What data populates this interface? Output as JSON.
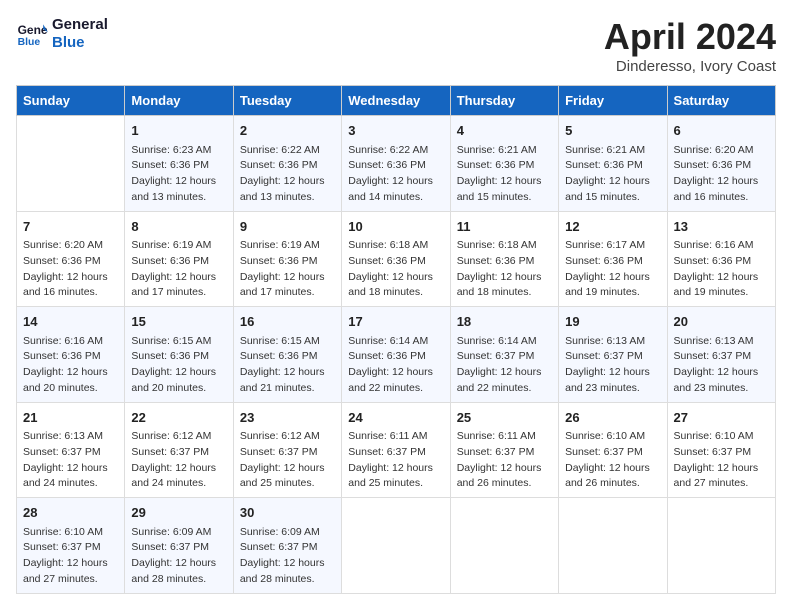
{
  "header": {
    "logo_line1": "General",
    "logo_line2": "Blue",
    "title": "April 2024",
    "location": "Dinderesso, Ivory Coast"
  },
  "days_of_week": [
    "Sunday",
    "Monday",
    "Tuesday",
    "Wednesday",
    "Thursday",
    "Friday",
    "Saturday"
  ],
  "weeks": [
    [
      {
        "day": "",
        "info": ""
      },
      {
        "day": "1",
        "info": "Sunrise: 6:23 AM\nSunset: 6:36 PM\nDaylight: 12 hours\nand 13 minutes."
      },
      {
        "day": "2",
        "info": "Sunrise: 6:22 AM\nSunset: 6:36 PM\nDaylight: 12 hours\nand 13 minutes."
      },
      {
        "day": "3",
        "info": "Sunrise: 6:22 AM\nSunset: 6:36 PM\nDaylight: 12 hours\nand 14 minutes."
      },
      {
        "day": "4",
        "info": "Sunrise: 6:21 AM\nSunset: 6:36 PM\nDaylight: 12 hours\nand 15 minutes."
      },
      {
        "day": "5",
        "info": "Sunrise: 6:21 AM\nSunset: 6:36 PM\nDaylight: 12 hours\nand 15 minutes."
      },
      {
        "day": "6",
        "info": "Sunrise: 6:20 AM\nSunset: 6:36 PM\nDaylight: 12 hours\nand 16 minutes."
      }
    ],
    [
      {
        "day": "7",
        "info": "Sunrise: 6:20 AM\nSunset: 6:36 PM\nDaylight: 12 hours\nand 16 minutes."
      },
      {
        "day": "8",
        "info": "Sunrise: 6:19 AM\nSunset: 6:36 PM\nDaylight: 12 hours\nand 17 minutes."
      },
      {
        "day": "9",
        "info": "Sunrise: 6:19 AM\nSunset: 6:36 PM\nDaylight: 12 hours\nand 17 minutes."
      },
      {
        "day": "10",
        "info": "Sunrise: 6:18 AM\nSunset: 6:36 PM\nDaylight: 12 hours\nand 18 minutes."
      },
      {
        "day": "11",
        "info": "Sunrise: 6:18 AM\nSunset: 6:36 PM\nDaylight: 12 hours\nand 18 minutes."
      },
      {
        "day": "12",
        "info": "Sunrise: 6:17 AM\nSunset: 6:36 PM\nDaylight: 12 hours\nand 19 minutes."
      },
      {
        "day": "13",
        "info": "Sunrise: 6:16 AM\nSunset: 6:36 PM\nDaylight: 12 hours\nand 19 minutes."
      }
    ],
    [
      {
        "day": "14",
        "info": "Sunrise: 6:16 AM\nSunset: 6:36 PM\nDaylight: 12 hours\nand 20 minutes."
      },
      {
        "day": "15",
        "info": "Sunrise: 6:15 AM\nSunset: 6:36 PM\nDaylight: 12 hours\nand 20 minutes."
      },
      {
        "day": "16",
        "info": "Sunrise: 6:15 AM\nSunset: 6:36 PM\nDaylight: 12 hours\nand 21 minutes."
      },
      {
        "day": "17",
        "info": "Sunrise: 6:14 AM\nSunset: 6:36 PM\nDaylight: 12 hours\nand 22 minutes."
      },
      {
        "day": "18",
        "info": "Sunrise: 6:14 AM\nSunset: 6:37 PM\nDaylight: 12 hours\nand 22 minutes."
      },
      {
        "day": "19",
        "info": "Sunrise: 6:13 AM\nSunset: 6:37 PM\nDaylight: 12 hours\nand 23 minutes."
      },
      {
        "day": "20",
        "info": "Sunrise: 6:13 AM\nSunset: 6:37 PM\nDaylight: 12 hours\nand 23 minutes."
      }
    ],
    [
      {
        "day": "21",
        "info": "Sunrise: 6:13 AM\nSunset: 6:37 PM\nDaylight: 12 hours\nand 24 minutes."
      },
      {
        "day": "22",
        "info": "Sunrise: 6:12 AM\nSunset: 6:37 PM\nDaylight: 12 hours\nand 24 minutes."
      },
      {
        "day": "23",
        "info": "Sunrise: 6:12 AM\nSunset: 6:37 PM\nDaylight: 12 hours\nand 25 minutes."
      },
      {
        "day": "24",
        "info": "Sunrise: 6:11 AM\nSunset: 6:37 PM\nDaylight: 12 hours\nand 25 minutes."
      },
      {
        "day": "25",
        "info": "Sunrise: 6:11 AM\nSunset: 6:37 PM\nDaylight: 12 hours\nand 26 minutes."
      },
      {
        "day": "26",
        "info": "Sunrise: 6:10 AM\nSunset: 6:37 PM\nDaylight: 12 hours\nand 26 minutes."
      },
      {
        "day": "27",
        "info": "Sunrise: 6:10 AM\nSunset: 6:37 PM\nDaylight: 12 hours\nand 27 minutes."
      }
    ],
    [
      {
        "day": "28",
        "info": "Sunrise: 6:10 AM\nSunset: 6:37 PM\nDaylight: 12 hours\nand 27 minutes."
      },
      {
        "day": "29",
        "info": "Sunrise: 6:09 AM\nSunset: 6:37 PM\nDaylight: 12 hours\nand 28 minutes."
      },
      {
        "day": "30",
        "info": "Sunrise: 6:09 AM\nSunset: 6:37 PM\nDaylight: 12 hours\nand 28 minutes."
      },
      {
        "day": "",
        "info": ""
      },
      {
        "day": "",
        "info": ""
      },
      {
        "day": "",
        "info": ""
      },
      {
        "day": "",
        "info": ""
      }
    ]
  ]
}
